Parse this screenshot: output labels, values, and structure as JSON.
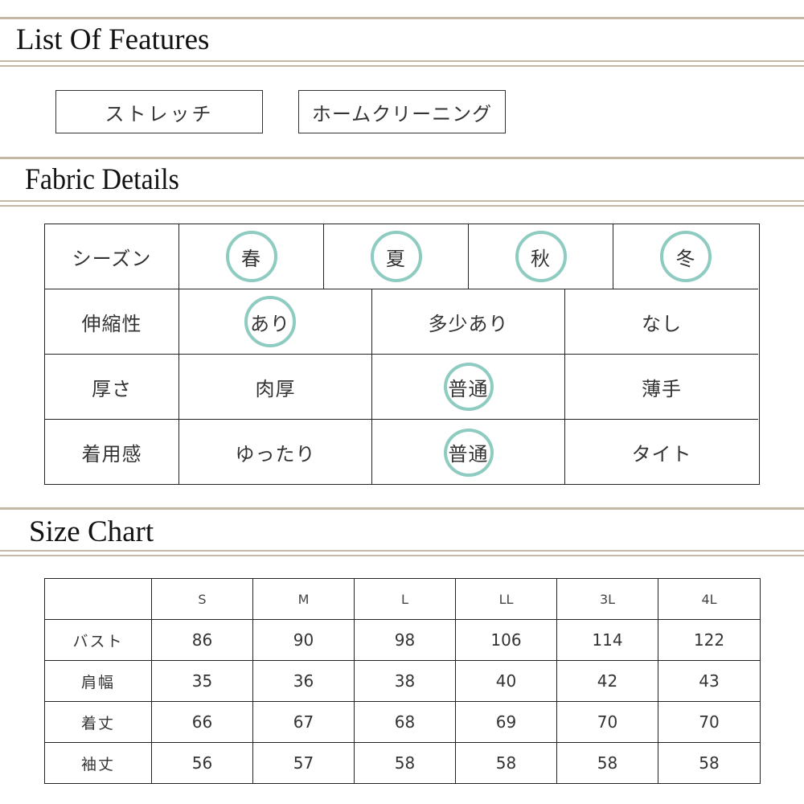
{
  "sections": {
    "features_title": "List Of Features",
    "fabric_title": "Fabric Details",
    "size_title": "Size Chart"
  },
  "features": [
    "ストレッチ",
    "ホームクリーニング"
  ],
  "fabric": {
    "accent_color": "#8ecbc0",
    "rows": [
      {
        "label": "シーズン",
        "options": [
          "春",
          "夏",
          "秋",
          "冬"
        ],
        "selected": [
          "春",
          "夏",
          "秋",
          "冬"
        ]
      },
      {
        "label": "伸縮性",
        "options": [
          "あり",
          "多少あり",
          "なし"
        ],
        "selected": [
          "あり"
        ]
      },
      {
        "label": "厚さ",
        "options": [
          "肉厚",
          "普通",
          "薄手"
        ],
        "selected": [
          "普通"
        ]
      },
      {
        "label": "着用感",
        "options": [
          "ゆったり",
          "普通",
          "タイト"
        ],
        "selected": [
          "普通"
        ]
      }
    ]
  },
  "size_chart": {
    "columns": [
      "",
      "S",
      "M",
      "L",
      "LL",
      "3L",
      "4L"
    ],
    "rows": [
      {
        "label": "バスト",
        "values": [
          "86",
          "90",
          "98",
          "106",
          "114",
          "122"
        ]
      },
      {
        "label": "肩幅",
        "values": [
          "35",
          "36",
          "38",
          "40",
          "42",
          "43"
        ]
      },
      {
        "label": "着丈",
        "values": [
          "66",
          "67",
          "68",
          "69",
          "70",
          "70"
        ]
      },
      {
        "label": "袖丈",
        "values": [
          "56",
          "57",
          "58",
          "58",
          "58",
          "58"
        ]
      }
    ]
  }
}
